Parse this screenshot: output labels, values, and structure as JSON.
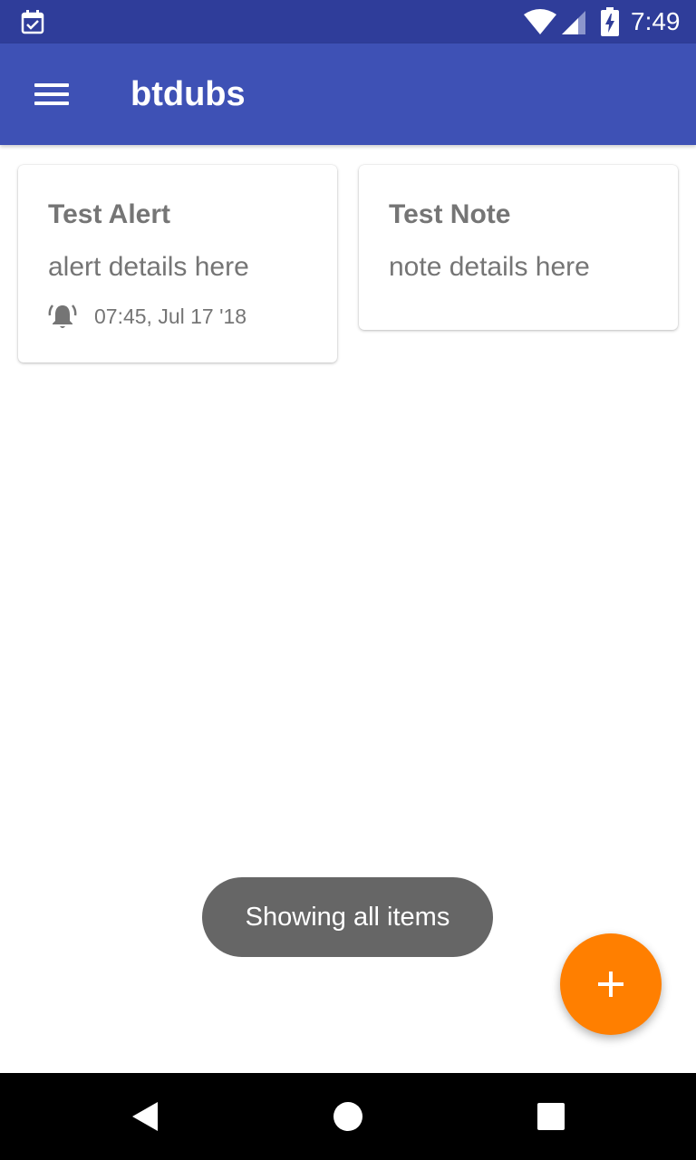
{
  "status_bar": {
    "time": "7:49",
    "icons": [
      "calendar-check-icon",
      "wifi-icon",
      "cell-signal-icon",
      "battery-charging-icon"
    ]
  },
  "app_bar": {
    "title": "btdubs",
    "menu_icon": "hamburger-menu-icon"
  },
  "cards": [
    {
      "title": "Test Alert",
      "details": "alert details here",
      "alarm_icon": "alarm-bell-icon",
      "alarm_time": "07:45, Jul 17 '18"
    },
    {
      "title": "Test Note",
      "details": "note details here"
    }
  ],
  "toast": {
    "message": "Showing all items"
  },
  "fab": {
    "icon": "plus-icon",
    "color": "#ff7f00"
  },
  "colors": {
    "status_bar": "#2f3d9a",
    "app_bar": "#3e51b5",
    "card_text": "#757575",
    "toast_bg": "#666666"
  },
  "nav_bar": {
    "icons": [
      "back-icon",
      "home-icon",
      "recents-icon"
    ]
  }
}
